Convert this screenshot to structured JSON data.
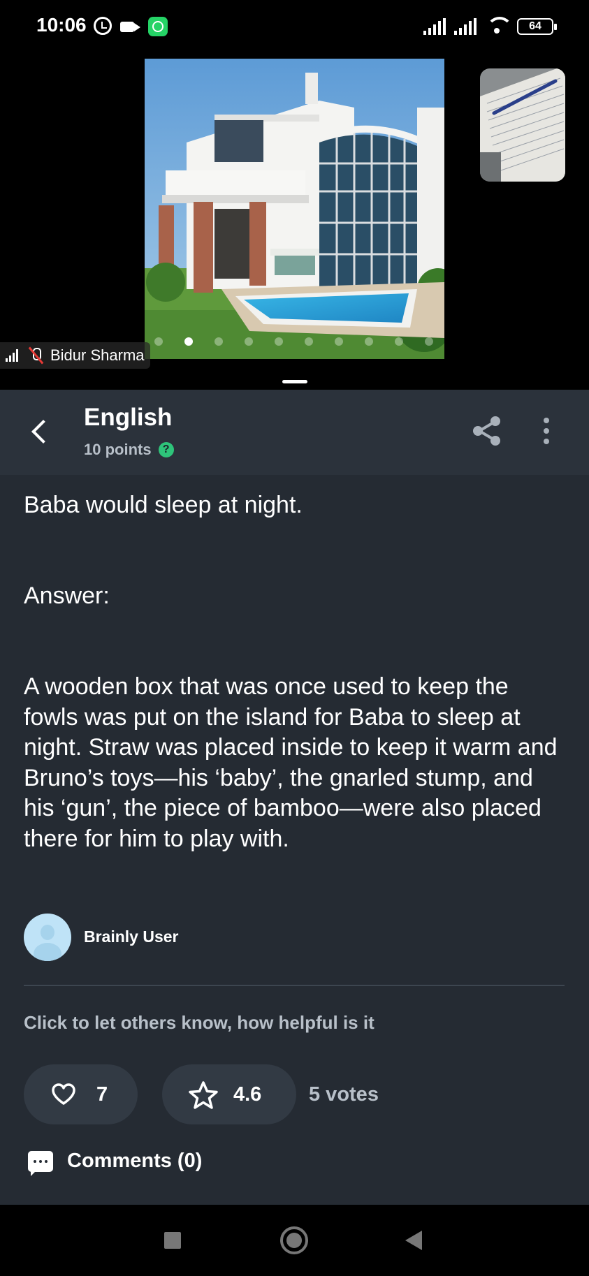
{
  "status_bar": {
    "time": "10:06",
    "battery": "64",
    "icons": [
      "alarm-icon",
      "video-call-icon",
      "whatsapp-icon",
      "signal-icon",
      "signal-icon",
      "wifi-icon",
      "battery-icon"
    ]
  },
  "video_call": {
    "participant_name": "Bidur Sharma",
    "carousel_total": 10,
    "carousel_active": 2
  },
  "header": {
    "subject": "English",
    "points": "10 points",
    "help_glyph": "?"
  },
  "question": {
    "text": "Baba would sleep at night."
  },
  "answer": {
    "label": "Answer:",
    "body": "A wooden box that was once used to keep the fowls was put on the island for Baba to sleep at night. Straw was placed inside to keep it warm and Bruno’s toys—his ‘baby’, the gnarled stump, and his ‘gun’, the piece of bamboo—were also placed there for him to play with.",
    "author": "Brainly User"
  },
  "feedback": {
    "prompt": "Click to let others know, how helpful is it",
    "likes": "7",
    "rating": "4.6",
    "votes": "5 votes",
    "comments": "Comments (0)"
  },
  "colors": {
    "app_background": "#252b33",
    "header_background": "#2b323b",
    "pill_background": "#323a44",
    "accent_green": "#2ec47a",
    "muted_text": "#b8c0c9"
  }
}
